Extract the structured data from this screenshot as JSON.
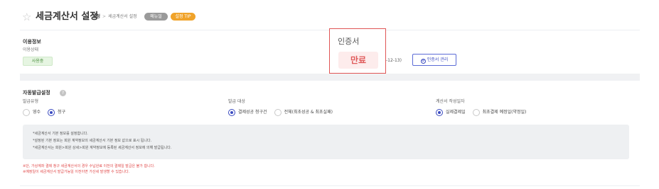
{
  "header": {
    "star_icon": "star-outline-icon",
    "title": "세금계산서 설정",
    "breadcrumb": [
      "설정",
      "세금계산서 설정"
    ],
    "breadcrumb_sep": ">",
    "manual_button": "메뉴얼",
    "tip_button": "설정 TIP"
  },
  "usage": {
    "title": "이용정보",
    "status_label": "이용상태",
    "status_value": "사용중"
  },
  "certificate": {
    "title": "인증서",
    "status": "만료",
    "date_fragment": "-12-13)",
    "manage_button": "인증서 관리"
  },
  "auto_issue": {
    "title": "자동발급설정",
    "help_icon": "?",
    "issue_type": {
      "label": "발급유형",
      "options": [
        {
          "label": "영수",
          "selected": false
        },
        {
          "label": "청구",
          "selected": true
        }
      ]
    },
    "target": {
      "label": "발급 대상",
      "options": [
        {
          "label": "결제성공 청구건",
          "selected": true
        },
        {
          "label": "전체(최초성공 & 최초실패)",
          "selected": false
        }
      ]
    },
    "date": {
      "label": "계산서 작성일자",
      "options": [
        {
          "label": "실제결제일",
          "selected": true
        },
        {
          "label": "최초결제 예정일(약정일)",
          "selected": false
        }
      ]
    }
  },
  "notice": {
    "lines": [
      "*세금계산서 기본 정보를 설정합니다.",
      "*설정된 기본 정보는 회원 계약정보의 세금계산서 기본 정보 값으로 표시 됩니다.",
      "*세금계산서는 회원>회원 상세>회원 계약정보에 등록된 세금계산서 정보에 의해 발급됩니다."
    ]
  },
  "warnings": [
    "※단, 가상계좌 결제 청구 세금계산서의 경우 수납완료 이전의 결제일 발급은 불가 합니다.",
    "※예정일이 세금계산서 발급가능일 이전이면 가산세 발생할 수 있습니다."
  ],
  "colors": {
    "accent": "#3b4bc0",
    "expired_red": "#e05a5a",
    "tip_orange": "#f0a32a",
    "active_green": "#4b8f3f",
    "warning_red": "#e04848"
  }
}
